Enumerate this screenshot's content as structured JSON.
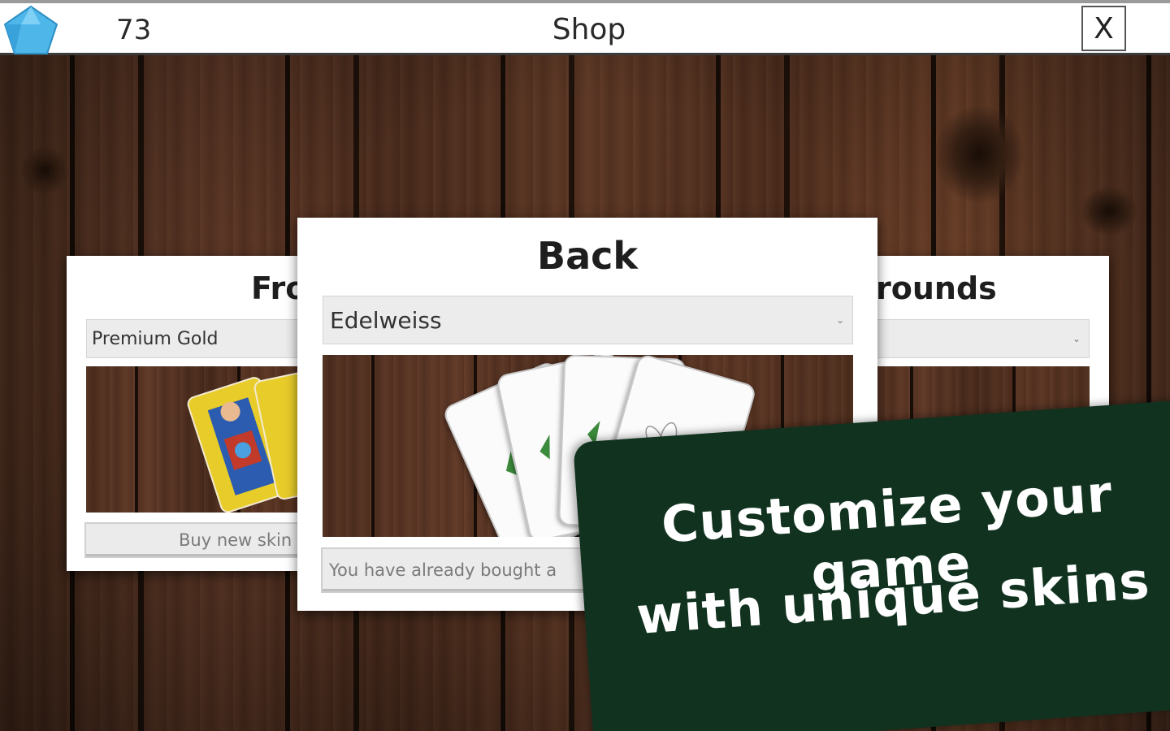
{
  "header": {
    "currency_icon": "gem-icon",
    "currency_amount": "73",
    "title": "Shop",
    "close_label": "X"
  },
  "panels": {
    "front": {
      "title": "Fro",
      "selected_skin": "Premium Gold",
      "button_label": "Buy new skin"
    },
    "back": {
      "title": "Back",
      "selected_skin": "Edelweiss",
      "button_label": "You have already bought a"
    },
    "backgrounds": {
      "title": "rounds",
      "selected_skin": ""
    }
  },
  "banner": {
    "line1": "Customize your game",
    "line2": "with unique skins"
  },
  "colors": {
    "banner_bg": "#11321f",
    "gem": "#4fb6ea",
    "card_yellow": "#e8cc2a"
  }
}
